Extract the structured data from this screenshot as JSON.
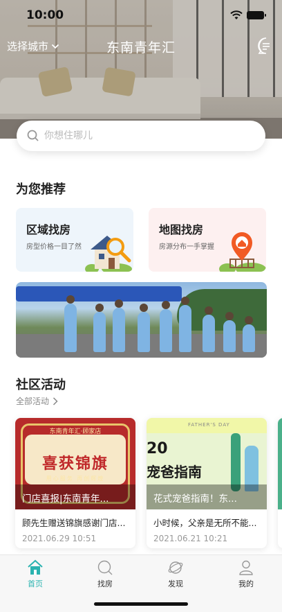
{
  "status_bar": {
    "time": "10:00"
  },
  "header": {
    "city_select_label": "选择城市",
    "app_title": "东南青年汇"
  },
  "search": {
    "placeholder": "你想住哪儿"
  },
  "recommend": {
    "title": "为您推荐",
    "cards": [
      {
        "title": "区域找房",
        "subtitle": "房型价格一目了然"
      },
      {
        "title": "地图找房",
        "subtitle": "房源分布一手掌握"
      }
    ]
  },
  "activities": {
    "title": "社区活动",
    "more_label": "全部活动",
    "items": [
      {
        "overlay": "门店喜报|东南青年...",
        "description": "顾先生赠送锦旗感谢门店...",
        "date": "2021.06.29 10:51",
        "image_text": {
          "store": "东南青年汇·顾家店",
          "headline": "喜获锦旗",
          "motto": "用心服务 再创辉煌"
        }
      },
      {
        "overlay": "花式宠爸指南！东...",
        "description": "小时候，父亲是无所不能...",
        "date": "2021.06.21 10:21",
        "image_text": {
          "day": "FATHER'S DAY",
          "number": "20",
          "headline": "宠爸指南"
        }
      }
    ]
  },
  "tab_bar": {
    "items": [
      {
        "label": "首页",
        "active": true
      },
      {
        "label": "找房",
        "active": false
      },
      {
        "label": "发现",
        "active": false
      },
      {
        "label": "我的",
        "active": false
      }
    ]
  },
  "colors": {
    "accent": "#2bb3b0",
    "area_card_bg": "#eef5fb",
    "map_card_bg": "#fdf0f0",
    "map_pin": "#f15a24"
  }
}
